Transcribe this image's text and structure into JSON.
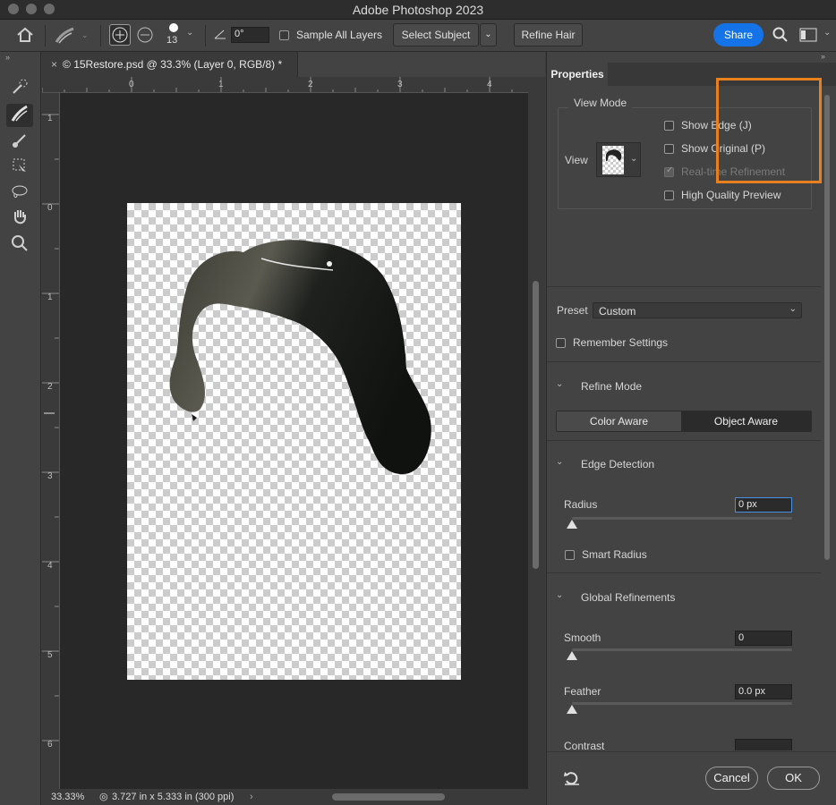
{
  "app": {
    "title": "Adobe Photoshop 2023"
  },
  "options_bar": {
    "brush_size": "13",
    "angle": "0°",
    "sample_all_layers": "Sample All Layers",
    "select_subject": "Select Subject",
    "refine_hair": "Refine Hair",
    "share": "Share"
  },
  "document": {
    "tab_title": "15Restore.psd @ 33.3% (Layer 0, RGB/8) *",
    "zoom": "33.33%",
    "doc_info": "3.727 in x 5.333 in (300 ppi)",
    "ruler_top": [
      "0",
      "1",
      "2",
      "3",
      "4"
    ],
    "ruler_left": [
      "1",
      "0",
      "1",
      "2",
      "3",
      "4",
      "5",
      "6"
    ]
  },
  "properties": {
    "tab": "Properties",
    "view_mode": {
      "heading": "View Mode",
      "view_label": "View",
      "show_edge": "Show Edge (J)",
      "show_original": "Show Original (P)",
      "realtime_refinement": "Real-time Refinement",
      "high_quality_preview": "High Quality Preview"
    },
    "preset": {
      "label": "Preset",
      "value": "Custom"
    },
    "remember_settings": "Remember Settings",
    "refine_mode": {
      "heading": "Refine Mode",
      "color_aware": "Color Aware",
      "object_aware": "Object Aware"
    },
    "edge_detection": {
      "heading": "Edge Detection",
      "radius_label": "Radius",
      "radius_value": "0 px",
      "smart_radius": "Smart Radius"
    },
    "global_refinements": {
      "heading": "Global Refinements",
      "smooth_label": "Smooth",
      "smooth_value": "0",
      "feather_label": "Feather",
      "feather_value": "0.0 px",
      "contrast_label": "Contrast"
    },
    "cancel": "Cancel",
    "ok": "OK"
  }
}
